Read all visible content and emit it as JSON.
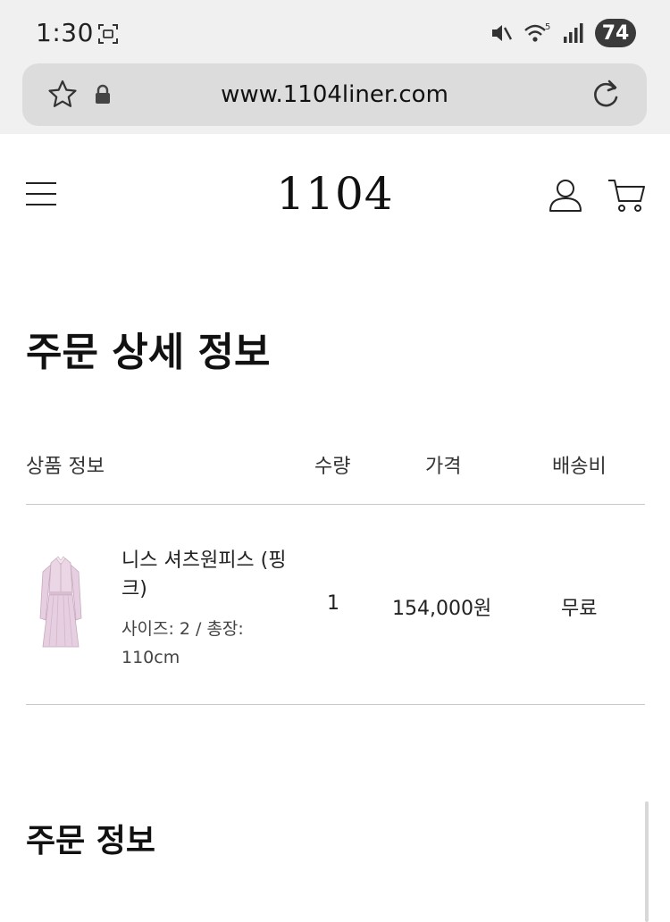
{
  "status_bar": {
    "time": "1:30",
    "network_label": "5",
    "battery": "74"
  },
  "browser": {
    "url": "www.1104liner.com"
  },
  "site": {
    "logo": "1104"
  },
  "page": {
    "title": "주문 상세 정보",
    "section_title": "주문 정보"
  },
  "table": {
    "headers": {
      "product": "상품 정보",
      "quantity": "수량",
      "price": "가격",
      "shipping": "배송비"
    },
    "rows": [
      {
        "name": "니스 셔츠원피스 (핑크)",
        "option": "사이즈: 2 / 총장: 110cm",
        "quantity": "1",
        "price": "154,000원",
        "shipping": "무료"
      }
    ]
  },
  "icons": {
    "status": [
      "screenshot-icon",
      "mute-icon",
      "wifi-icon",
      "signal-icon"
    ],
    "browser": [
      "star-icon",
      "lock-icon",
      "reload-icon"
    ],
    "header": [
      "menu-icon",
      "user-icon",
      "cart-icon"
    ]
  },
  "colors": {
    "chrome_bg": "#f0f0f0",
    "url_bar_bg": "#dcdcdc",
    "divider": "#c8c8c8",
    "battery_badge": "#3a3a3a",
    "dress_pink": "#e6cfe0"
  }
}
